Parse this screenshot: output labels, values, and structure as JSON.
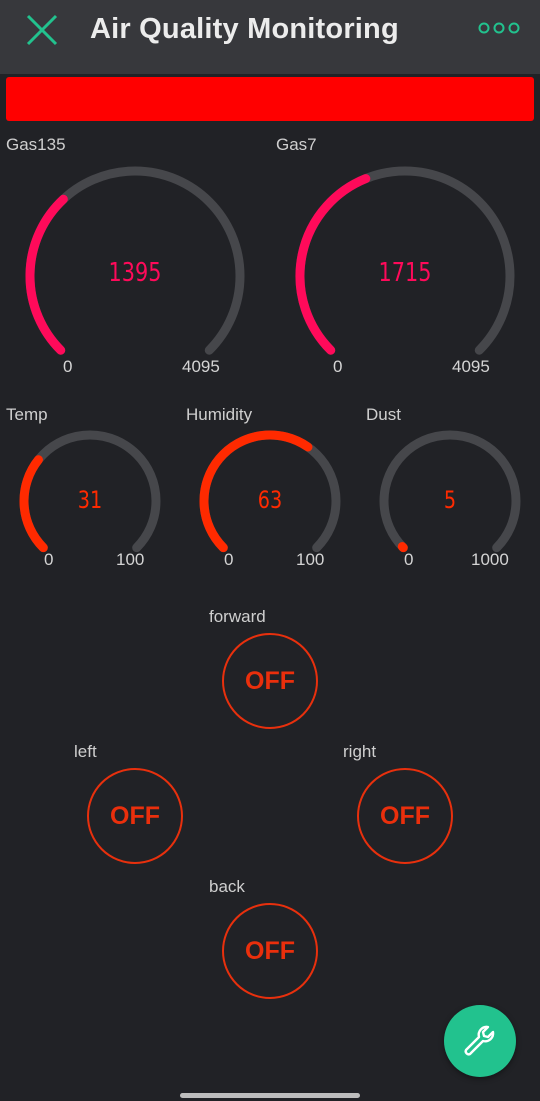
{
  "app": {
    "title": "Air Quality Monitoring"
  },
  "banner": {
    "color": "#ff0000"
  },
  "gauges": {
    "gas135": {
      "label": "Gas135",
      "value": "1395",
      "min": "0",
      "max": "4095",
      "color": "#ff0a5a"
    },
    "gas7": {
      "label": "Gas7",
      "value": "1715",
      "min": "0",
      "max": "4095",
      "color": "#ff0a5a"
    },
    "temp": {
      "label": "Temp",
      "value": "31",
      "min": "0",
      "max": "100",
      "color": "#ff2a00"
    },
    "humidity": {
      "label": "Humidity",
      "value": "63",
      "min": "0",
      "max": "100",
      "color": "#ff2a00"
    },
    "dust": {
      "label": "Dust",
      "value": "5",
      "min": "0",
      "max": "1000",
      "color": "#ff2a00"
    }
  },
  "controls": {
    "forward": {
      "label": "forward",
      "state": "OFF"
    },
    "left": {
      "label": "left",
      "state": "OFF"
    },
    "right": {
      "label": "right",
      "state": "OFF"
    },
    "back": {
      "label": "back",
      "state": "OFF"
    }
  },
  "icons": {
    "close": "close-icon",
    "more": "more-dots-icon",
    "settings": "wrench-icon"
  },
  "colors": {
    "accent": "#22c28e",
    "track": "#46474b",
    "button": "#e8300d"
  }
}
